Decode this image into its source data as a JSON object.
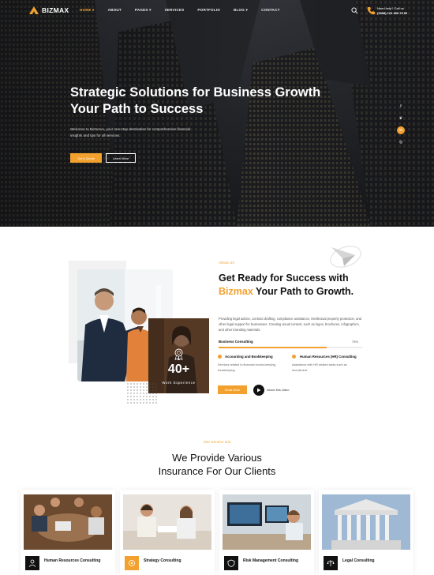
{
  "brand": {
    "name": "BIZMAX",
    "accent": "#f2a12f",
    "dark": "#111111"
  },
  "nav": {
    "items": [
      {
        "label": "HOME ▾",
        "active": true
      },
      {
        "label": "ABOUT",
        "active": false
      },
      {
        "label": "PAGES ▾",
        "active": false
      },
      {
        "label": "SERVICES",
        "active": false
      },
      {
        "label": "PORTFOLIO",
        "active": false
      },
      {
        "label": "BLOG ▾",
        "active": false
      },
      {
        "label": "CONTACT",
        "active": false
      }
    ],
    "search_icon": "search-icon",
    "call_title": "Need help? Call us",
    "call_number": "(0088) 123 456 78 90"
  },
  "hero": {
    "title": "Strategic Solutions for Business Growth Your Path to Success",
    "description": "Welcome to BizServe, your one-stop destination for comprehensive financial insights and tips for all services.",
    "primary_button": "Get A Quote",
    "secondary_button": "Learn More",
    "socials": [
      "f",
      "❦",
      "in",
      "◎"
    ]
  },
  "about": {
    "subtitle": "About Us",
    "title_before": "Get Ready for Success with ",
    "title_highlight": "Bizmax",
    "title_after": " Your Path to Growth.",
    "description": "Providing legal advice, contract drafting, compliance assistance, intellectual property protection, and other legal support for businesses. Creating visual content, such as logos, brochures, infographics, and other branding materials.",
    "progress": {
      "label": "Business Consulting",
      "percent_label": "75%",
      "value": 0.75
    },
    "features": [
      {
        "title": "Accounting and Bookkeeping",
        "desc": "Services related to financial record-keeping, bookkeeping."
      },
      {
        "title": "Human Resources (HR) Consulting",
        "desc": "Assistance with HR-related tasks such as recruitment."
      }
    ],
    "experience_number": "40+",
    "experience_label": "Work Experience",
    "read_more": "Read More",
    "play_label": "About this video"
  },
  "services": {
    "subtitle": "Our Service List",
    "title_line1": "We Provide Various",
    "title_line2": "Insurance For Our Clients",
    "cards": [
      {
        "title": "Human Resources Consulting",
        "icon": "hr-icon",
        "icon_bg": "#111111"
      },
      {
        "title": "Strategy Consulting",
        "icon": "strategy-icon",
        "icon_bg": "#f2a12f"
      },
      {
        "title": "Risk Management Consulting",
        "icon": "risk-icon",
        "icon_bg": "#111111"
      },
      {
        "title": "Legal Consulting",
        "icon": "legal-icon",
        "icon_bg": "#111111"
      }
    ]
  }
}
